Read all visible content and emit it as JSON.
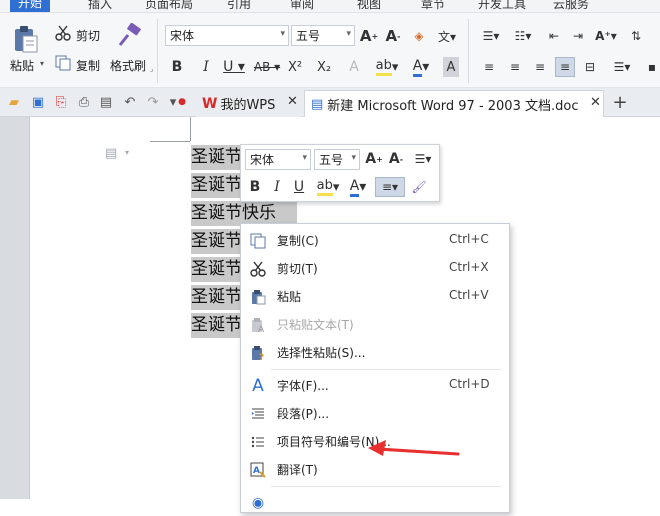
{
  "menu_tabs": [
    "开始",
    "插入",
    "页面布局",
    "引用",
    "审阅",
    "视图",
    "章节",
    "开发工具",
    "云服务"
  ],
  "ribbon": {
    "paste": "粘贴",
    "cut": "剪切",
    "copy": "复制",
    "format_painter": "格式刷",
    "font_name": "宋体",
    "font_size": "五号"
  },
  "quick_bar": {
    "tabs": [
      {
        "label": "我的WPS"
      },
      {
        "label": "新建 Microsoft Word 97 - 2003 文档.doc"
      }
    ],
    "new_tab": "+"
  },
  "document": {
    "lines": [
      "圣诞节",
      "圣诞节",
      "圣诞节快乐",
      "圣诞节",
      "圣诞节",
      "圣诞节",
      "圣诞节"
    ]
  },
  "mini_toolbar": {
    "font_name": "宋体",
    "font_size": "五号"
  },
  "context_menu": {
    "items": [
      {
        "label": "复制(C)",
        "shortcut": "Ctrl+C",
        "icon": "copy-icon"
      },
      {
        "label": "剪切(T)",
        "shortcut": "Ctrl+X",
        "icon": "scissors-icon"
      },
      {
        "label": "粘贴",
        "shortcut": "Ctrl+V",
        "icon": "paste-icon"
      },
      {
        "label": "只粘贴文本(T)",
        "shortcut": "",
        "icon": "paste-text-icon",
        "disabled": true
      },
      {
        "label": "选择性粘贴(S)...",
        "shortcut": "",
        "icon": "paste-special-icon"
      },
      {
        "label": "字体(F)...",
        "shortcut": "Ctrl+D",
        "icon": "font-icon"
      },
      {
        "label": "段落(P)...",
        "shortcut": "",
        "icon": "paragraph-icon"
      },
      {
        "label": "项目符号和编号(N)...",
        "shortcut": "",
        "icon": "bullet-list-icon"
      },
      {
        "label": "翻译(T)",
        "shortcut": "",
        "icon": "translate-icon"
      }
    ]
  },
  "colors": {
    "accent_blue": "#2f6fd4",
    "annotation_red": "#e8312f",
    "selection_gray": "#c9c9c9",
    "wps_red": "#d82a2a"
  }
}
